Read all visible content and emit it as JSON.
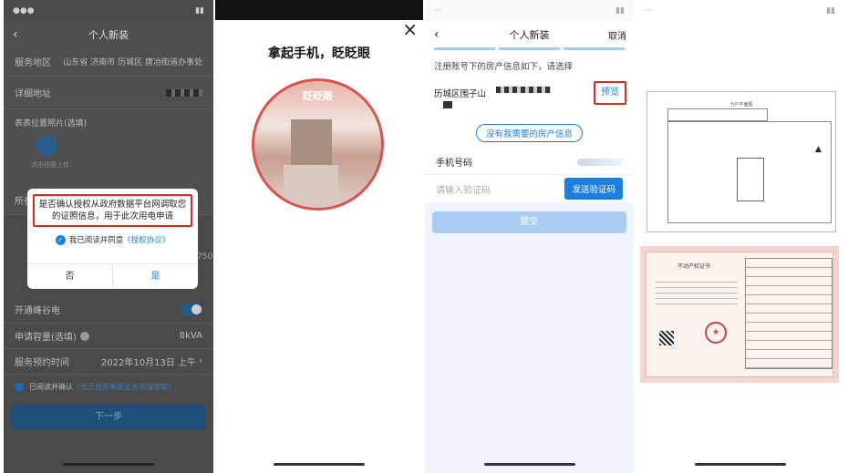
{
  "p1": {
    "title": "个人新装",
    "rows": [
      {
        "label": "服务地区",
        "value": "山东省 济南市 历城区 唐冶街道办事处"
      },
      {
        "label": "详细地址",
        "value": ""
      },
      {
        "label": "表表位置照片(选填)",
        "value": ""
      },
      {
        "label": "所在小区",
        "value": ""
      }
    ],
    "photo_label": "点击拍摄上传",
    "dialog": {
      "message": "是否确认授权从政府数据平台网调取您的证照信息，用于此次用电申请",
      "agree_text": "我已阅读并同意",
      "agree_link": "《授权协议》",
      "no": "否",
      "yes": "是"
    },
    "side_num": "750",
    "valley_label": "开通峰谷电",
    "capacity_label": "申请容量(选填)",
    "capacity_value": "8kVA",
    "time_label": "服务预约时间",
    "time_value": "2022年10月13日 上午",
    "notice_text": "已阅读并确认",
    "notice_link": "《低压居民新装业务办理须知》",
    "next_button": "下一步"
  },
  "p2": {
    "title": "拿起手机，眨眨眼",
    "face_label": "眨眨眼",
    "close": "×"
  },
  "p3": {
    "title": "个人新装",
    "cancel": "取消",
    "intro": "注册账号下的房产信息如下，请选择",
    "property": "历城区围子山",
    "preview": "预览",
    "no_property": "没有我需要的房产信息",
    "phone_label": "手机号码",
    "code_placeholder": "请输入验证码",
    "send_code": "发送验证码",
    "submit": "提交"
  },
  "p4": {
    "floorplan_title": "分户平面图",
    "cert_title": "不动产权证书"
  },
  "colors": {
    "accent": "#1b7fe0",
    "highlight": "#e0281c"
  }
}
